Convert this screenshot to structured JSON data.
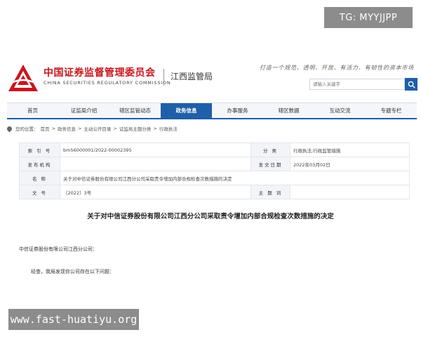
{
  "tg_badge": "TG: MYYJJPP",
  "header": {
    "org_cn": "中国证券监督管理委员会",
    "org_en": "CHINA SECURITIES REGULATORY COMMISSION",
    "bureau": "江西监管局",
    "slogan": "打造一个规范、透明、开放、有活力、有韧性的资本市场",
    "search_placeholder": "请输入关键字"
  },
  "nav": {
    "items": [
      {
        "label": "首页",
        "active": false
      },
      {
        "label": "证监局介绍",
        "active": false
      },
      {
        "label": "辖区监管动态",
        "active": false
      },
      {
        "label": "政务信息",
        "active": true
      },
      {
        "label": "办事服务",
        "active": false
      },
      {
        "label": "辖区数据",
        "active": false
      },
      {
        "label": "互动交流",
        "active": false
      },
      {
        "label": "专题专栏",
        "active": false
      }
    ]
  },
  "breadcrumb": {
    "prefix": "您的位置：",
    "items": [
      "首页",
      "政务信息",
      "主动公开目录",
      "证监局主题分类",
      "行政执法"
    ],
    "separator": ">"
  },
  "meta": {
    "index_label": "索 引 号",
    "index_value": "bm56000001/2022-00002395",
    "category_label": "分 类",
    "category_value": "行政执法;行政监管措施",
    "issuer_label": "发布机构",
    "issuer_value": "",
    "date_label": "发文日期",
    "date_value": "2022年03月02日",
    "name_label": "名 称",
    "name_value": "关于对中信证券股份有限公司江西分公司采取责令增加内部合规检查次数措施的决定",
    "docno_label": "文 号",
    "docno_value": "〔2022〕3号",
    "subject_label": "主 题 词",
    "subject_value": ""
  },
  "document": {
    "title": "关于对中信证券股份有限公司江西分公司采取责令增加内部合规检查次数措施的决定",
    "addressee": "中信证券股份有限公司江西分公司：",
    "body_first": "经查，我局发现你公司存在以下问题："
  },
  "watermark": "www.fast-huatiyu.org",
  "colors": {
    "brand_red": "#c8161d",
    "nav_blue": "#1f5fa8"
  }
}
